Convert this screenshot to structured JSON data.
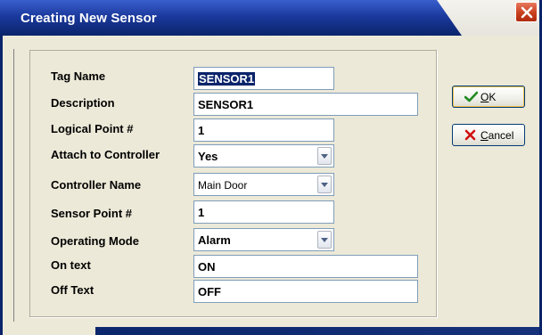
{
  "window": {
    "title": "Creating New Sensor"
  },
  "form": {
    "tag_name": {
      "label": "Tag Name",
      "value": "SENSOR1"
    },
    "description": {
      "label": "Description",
      "value": "SENSOR1"
    },
    "logical_point": {
      "label": "Logical Point #",
      "value": "1"
    },
    "attach": {
      "label": "Attach to Controller",
      "value": "Yes"
    },
    "controller_name": {
      "label": "Controller Name",
      "value": "Main Door"
    },
    "sensor_point": {
      "label": "Sensor Point #",
      "value": "1"
    },
    "operating_mode": {
      "label": "Operating Mode",
      "value": "Alarm"
    },
    "on_text": {
      "label": "On text",
      "value": "ON"
    },
    "off_text": {
      "label": "Off Text",
      "value": "OFF"
    }
  },
  "buttons": {
    "ok": {
      "mnemonic": "O",
      "rest": "K"
    },
    "cancel": {
      "mnemonic": "C",
      "rest": "ancel"
    }
  },
  "icons": {
    "close": "close-icon",
    "ok": "checkmark-icon",
    "cancel": "x-icon",
    "dropdown": "chevron-down-icon"
  },
  "colors": {
    "title_bar": "#0a246a",
    "close_button": "#c9401f",
    "ok_check": "#1f8a1f",
    "cancel_x": "#d01010"
  }
}
